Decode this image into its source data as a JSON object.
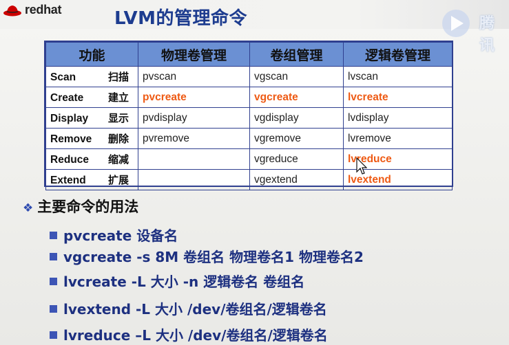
{
  "logo": {
    "text": "redhat"
  },
  "title": "LVM的管理命令",
  "watermark": {
    "text": "腾讯"
  },
  "table": {
    "headers": [
      "功能",
      "物理卷管理",
      "卷组管理",
      "逻辑卷管理"
    ],
    "rows": [
      {
        "en": "Scan",
        "zh": "扫描",
        "pv": "pvscan",
        "vg": "vgscan",
        "lv": "lvscan"
      },
      {
        "en": "Create",
        "zh": "建立",
        "pv": "pvcreate",
        "vg": "vgcreate",
        "lv": "lvcreate"
      },
      {
        "en": "Display",
        "zh": "显示",
        "pv": "pvdisplay",
        "vg": "vgdisplay",
        "lv": "lvdisplay"
      },
      {
        "en": "Remove",
        "zh": "删除",
        "pv": "pvremove",
        "vg": "vgremove",
        "lv": "lvremove"
      },
      {
        "en": "Reduce",
        "zh": "缩减",
        "pv": "",
        "vg": "vgreduce",
        "lv": "lvreduce"
      },
      {
        "en": "Extend",
        "zh": "扩展",
        "pv": "",
        "vg": "vgextend",
        "lv": "lvextend"
      }
    ],
    "highlight_color": "#ee5a14"
  },
  "section_title": "主要命令的用法",
  "commands": [
    "pvcreate 设备名",
    "vgcreate -s 8M 卷组名 物理卷名1 物理卷名2",
    "lvcreate  -L  大小 -n  逻辑卷名 卷组名",
    "lvextend  -L  大小  /dev/卷组名/逻辑卷名",
    "lvreduce –L 大小  /dev/卷组名/逻辑卷名"
  ],
  "colors": {
    "title": "#1d3c8f",
    "header_bg": "#6b90d3",
    "command_text": "#1d3080",
    "bullet": "#3d55b5"
  }
}
